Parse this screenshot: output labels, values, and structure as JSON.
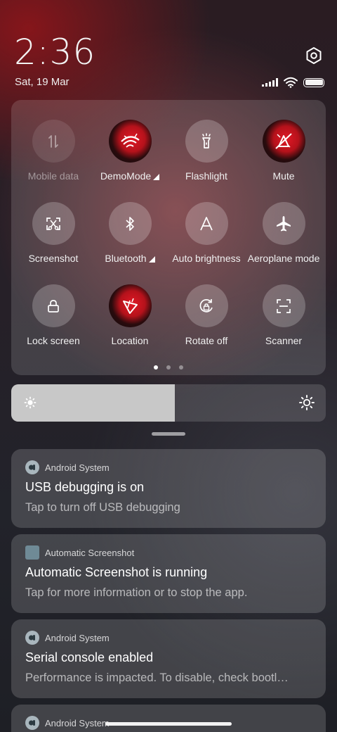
{
  "status": {
    "time": "2:36",
    "date": "Sat, 19 Mar",
    "icons": [
      "signal-icon",
      "wifi-icon",
      "battery-icon"
    ]
  },
  "quick_settings": {
    "tiles": [
      {
        "label": "Mobile data",
        "icon": "mobile-data-icon",
        "state": "disabled"
      },
      {
        "label": "DemoMode",
        "icon": "demomode-app-icon",
        "state": "active",
        "expand": true
      },
      {
        "label": "Flashlight",
        "icon": "flashlight-icon",
        "state": "off"
      },
      {
        "label": "Mute",
        "icon": "mute-app-icon",
        "state": "active"
      },
      {
        "label": "Screenshot",
        "icon": "screenshot-icon",
        "state": "off"
      },
      {
        "label": "Bluetooth",
        "icon": "bluetooth-icon",
        "state": "off",
        "expand": true
      },
      {
        "label": "Auto brightness",
        "icon": "auto-brightness-icon",
        "state": "off"
      },
      {
        "label": "Aeroplane mode",
        "icon": "aeroplane-icon",
        "state": "off"
      },
      {
        "label": "Lock screen",
        "icon": "lock-icon",
        "state": "off"
      },
      {
        "label": "Location",
        "icon": "location-app-icon",
        "state": "active"
      },
      {
        "label": "Rotate off",
        "icon": "rotate-lock-icon",
        "state": "off"
      },
      {
        "label": "Scanner",
        "icon": "scanner-icon",
        "state": "off"
      }
    ],
    "pages": 3,
    "current_page": 1
  },
  "brightness": {
    "level": 0.52
  },
  "notifications": [
    {
      "app": "Android System",
      "app_icon": "android-system-icon",
      "title": "USB debugging is on",
      "body": "Tap to turn off USB debugging"
    },
    {
      "app": "Automatic Screenshot",
      "app_icon": "automatic-screenshot-icon",
      "title": "Automatic Screenshot is running",
      "body": "Tap for more information or to stop the app."
    },
    {
      "app": "Android System",
      "app_icon": "android-system-icon",
      "title": "Serial console enabled",
      "body": "Performance is impacted. To disable, check bootl…"
    },
    {
      "app": "Android System",
      "app_icon": "android-system-icon",
      "title": "",
      "body": ""
    }
  ],
  "colors": {
    "accent_red": "#d3141e",
    "panel": "rgba(255,255,255,0.14)"
  }
}
